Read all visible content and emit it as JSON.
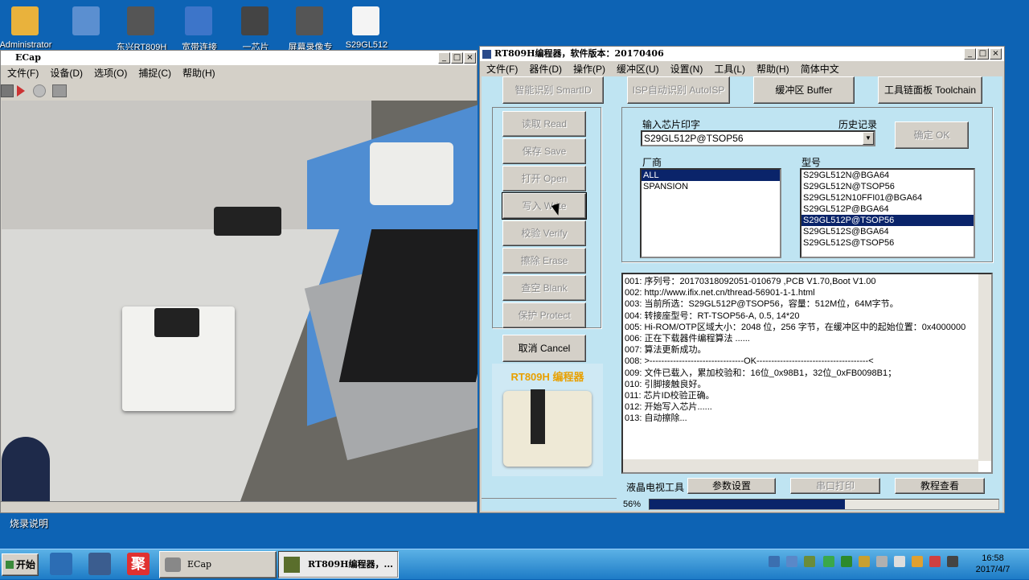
{
  "desktop": {
    "icons": [
      {
        "label": "Administrator",
        "color": "#e9b23c"
      },
      {
        "label": "",
        "color": "#5b8fd0"
      },
      {
        "label": "东兴RT809H",
        "color": "#555"
      },
      {
        "label": "宽带连接",
        "color": "#3d75c9"
      },
      {
        "label": "一芯片",
        "color": "#444"
      },
      {
        "label": "屏幕录像专",
        "color": "#555"
      },
      {
        "label": "S29GL512",
        "color": "#f4f4f4"
      }
    ],
    "bottom_label": "烧录说明"
  },
  "ecap": {
    "title": "ECap",
    "menu": [
      "文件(F)",
      "设备(D)",
      "选项(O)",
      "捕捉(C)",
      "帮助(H)"
    ]
  },
  "rt": {
    "title": "RT809H编程器，软件版本：20170406",
    "menu": [
      "文件(F)",
      "器件(D)",
      "操作(P)",
      "缓冲区(U)",
      "设置(N)",
      "工具(L)",
      "帮助(H)",
      "简体中文"
    ],
    "top_buttons": {
      "smartid": "智能识别 SmartID",
      "autoisp": "ISP自动识别 AutoISP",
      "buffer": "缓冲区 Buffer",
      "toolchain": "工具链面板 Toolchain"
    },
    "ops": [
      "读取 Read",
      "保存 Save",
      "打开 Open",
      "写入 Write",
      "校验 Verify",
      "擦除 Erase",
      "查空 Blank",
      "保护 Protect"
    ],
    "cancel": "取消 Cancel",
    "image_label": "RT809H 编程器",
    "chip_label": "输入芯片印字",
    "history_label": "历史记录",
    "chip_value": "S29GL512P@TSOP56",
    "ok": "确定 OK",
    "vendor_label": "厂商",
    "model_label": "型号",
    "vendors": [
      "ALL",
      "SPANSION"
    ],
    "models": [
      "S29GL512N@BGA64",
      "S29GL512N@TSOP56",
      "S29GL512N10FFI01@BGA64",
      "S29GL512P@BGA64",
      "S29GL512P@TSOP56",
      "S29GL512S@BGA64",
      "S29GL512S@TSOP56"
    ],
    "log": [
      "001:  序列号：20170318092051-010679  ,PCB V1.70,Boot V1.00",
      "002:  http://www.ifix.net.cn/thread-56901-1-1.html",
      "003:  当前所选：S29GL512P@TSOP56，容量：512M位，64M字节。",
      "004:  转接座型号：RT-TSOP56-A, 0.5, 14*20",
      "005:  Hi-ROM/OTP区域大小：2048 位，256 字节，在缓冲区中的起始位置：0x4000000",
      "006:  正在下载器件编程算法 ......",
      "007:  算法更新成功。",
      "008:  >--------------------------------OK--------------------------------------<",
      "009:  文件已载入，累加校验和：16位_0x98B1，32位_0xFB0098B1；",
      "010:  引脚接触良好。",
      "011:  芯片ID校验正确。",
      "012:  开始写入芯片......",
      "013:  自动擦除..."
    ],
    "bottom": {
      "lcd": "液晶电视工具",
      "params": "参数设置",
      "serial": "串口打印",
      "tutorial": "教程查看"
    },
    "progress_text": "56%",
    "progress": 0.56
  },
  "taskbar": {
    "start": "开始",
    "tasks": [
      {
        "label": "ECap"
      },
      {
        "label": "RT809H编程器，..."
      }
    ],
    "time": "16:58",
    "date": "2017/4/7"
  }
}
